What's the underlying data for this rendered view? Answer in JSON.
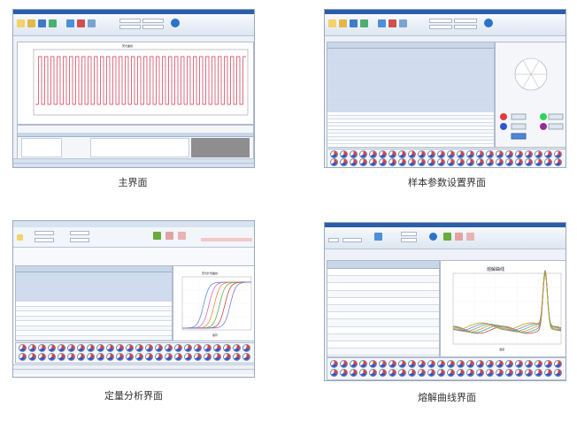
{
  "screenshots": [
    {
      "caption": "主界面"
    },
    {
      "caption": "样本参数设置界面"
    },
    {
      "caption": "定量分析界面"
    },
    {
      "caption": "熔解曲线界面"
    }
  ],
  "main": {
    "chart_title": "荧光曲线"
  },
  "quant": {
    "chart_title": "荧光扩增曲线",
    "xlabel": "循环"
  },
  "melt": {
    "chart_title": "熔解曲线",
    "xlabel": "温度"
  },
  "colors": {
    "titlebar": "#2a5ea8",
    "ribbon": "#dde6f2",
    "status": "#d7e1ef",
    "curve_red": "#d0344a",
    "selected_row": "#cfdcf0"
  }
}
